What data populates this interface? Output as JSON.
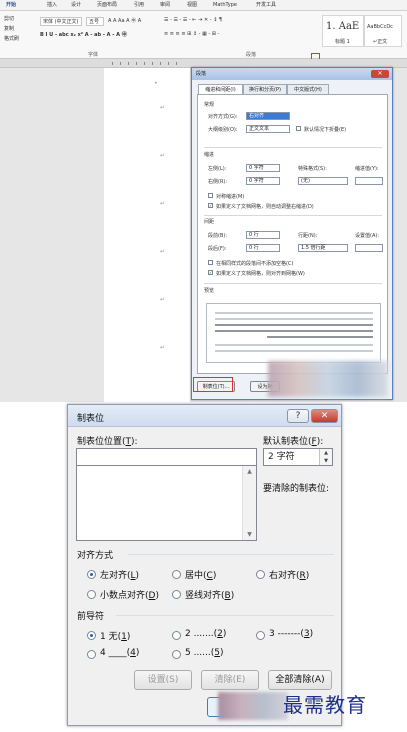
{
  "ribbon": {
    "tabs": [
      "开始",
      "插入",
      "设计",
      "页面布局",
      "引用",
      "审阅",
      "视图",
      "MathType",
      "开发工具"
    ],
    "clipboard": [
      "剪切",
      "复制",
      "格式刷"
    ],
    "font_name": "宋体 (中文正文)",
    "font_size": "五号",
    "font_group_label": "字体",
    "paragraph_group_label": "段落",
    "style1_preview": "1. AaE",
    "style1_name": "标题 1",
    "style2_preview": "AaBbCcDc",
    "style2_name": "↵正文"
  },
  "paragraph_dialog": {
    "title": "段落",
    "tabs": [
      "缩进和间距(I)",
      "换行和分页(P)",
      "中文版式(H)"
    ],
    "general_label": "常规",
    "alignment_label": "对齐方式(G):",
    "alignment_value": "右对齐",
    "outline_label": "大纲级别(O):",
    "outline_value": "正文文本",
    "collapsed_label": "默认情况下折叠(E)",
    "indent_label": "缩进",
    "left_label": "左侧(L):",
    "left_value": "0 字符",
    "right_label": "右侧(R):",
    "right_value": "0 字符",
    "special_label": "特殊格式(S):",
    "special_value": "(无)",
    "indent_by_label": "缩进值(Y):",
    "mirror_label": "对称缩进(M)",
    "auto_indent_label": "如果定义了文档网格，则自动调整右缩进(D)",
    "spacing_label": "间距",
    "before_label": "段前(B):",
    "before_value": "0 行",
    "after_label": "段后(F):",
    "after_value": "0 行",
    "line_spacing_label": "行距(N):",
    "line_spacing_value": "1.5 倍行距",
    "at_label": "设置值(A):",
    "no_space_label": "在相同样式的段落间不添加空格(C)",
    "snap_grid_label": "如果定义了文档网格，则对齐到网格(W)",
    "preview_label": "预览",
    "tabs_button": "制表位(T)...",
    "default_button": "设为默"
  },
  "tabs_dialog": {
    "title": "制表位",
    "help_icon": "?",
    "close_icon": "✕",
    "position_label": "制表位位置(",
    "position_key": "T",
    "position_tail": "):",
    "position_value": "",
    "default_label": "默认制表位(",
    "default_key": "F",
    "default_tail": "):",
    "default_value": "2 字符",
    "clear_label": "要清除的制表位:",
    "alignment_section": "对齐方式",
    "alignment_options": [
      {
        "text": "左对齐(",
        "key": "L",
        "tail": ")",
        "checked": true
      },
      {
        "text": "居中(",
        "key": "C",
        "tail": ")",
        "checked": false
      },
      {
        "text": "右对齐(",
        "key": "R",
        "tail": ")",
        "checked": false
      },
      {
        "text": "小数点对齐(",
        "key": "D",
        "tail": ")",
        "checked": false
      },
      {
        "text": "竖线对齐(",
        "key": "B",
        "tail": ")",
        "checked": false
      }
    ],
    "leader_section": "前导符",
    "leader_options": [
      {
        "text": "1 无(",
        "key": "1",
        "tail": ")",
        "checked": true
      },
      {
        "text": "2 .......(",
        "key": "2",
        "tail": ")",
        "checked": false
      },
      {
        "text": "3 -------(",
        "key": "3",
        "tail": ")",
        "checked": false
      },
      {
        "text": "4 ____(",
        "key": "4",
        "tail": ")",
        "checked": false
      },
      {
        "text": "5 ......(",
        "key": "5",
        "tail": ")",
        "checked": false
      }
    ],
    "set_button": "设置(S)",
    "clear_button": "清除(E)",
    "clear_all_button": "全部清除(A)"
  },
  "watermark": "最需教育"
}
